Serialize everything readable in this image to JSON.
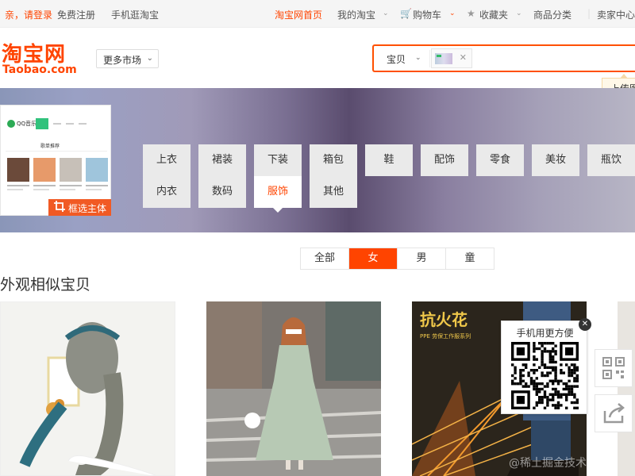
{
  "topbar": {
    "login": "亲，请登录",
    "register": "免费注册",
    "mobile": "手机逛淘宝",
    "home": "淘宝网首页",
    "my_taobao": "我的淘宝",
    "cart": "购物车",
    "favorites": "收藏夹",
    "categories": "商品分类",
    "separator": "|",
    "seller_center": "卖家中心",
    "chevron": "⌄",
    "cart_icon": "🛒",
    "star_icon": "★"
  },
  "header": {
    "logo_cn": "淘宝网",
    "logo_en": "Taobao.com",
    "more_markets": "更多市场",
    "chevron": "⌄"
  },
  "search": {
    "type_label": "宝贝",
    "type_chevron": "⌄",
    "remove_glyph": "✕",
    "upload_tip": "上传图"
  },
  "banner": {
    "preview": {
      "app_name": "QQ音乐",
      "section": "歌单推荐"
    },
    "crop_label": "框选主体",
    "categories": [
      {
        "label": "上衣",
        "active": false
      },
      {
        "label": "裙装",
        "active": false
      },
      {
        "label": "下装",
        "active": false
      },
      {
        "label": "箱包",
        "active": false
      },
      {
        "label": "鞋",
        "active": false
      },
      {
        "label": "配饰",
        "active": false
      },
      {
        "label": "零食",
        "active": false
      },
      {
        "label": "美妆",
        "active": false
      },
      {
        "label": "瓶饮",
        "active": false
      },
      {
        "label": "内衣",
        "active": false
      },
      {
        "label": "数码",
        "active": false
      },
      {
        "label": "服饰",
        "active": true
      },
      {
        "label": "其他",
        "active": false
      }
    ]
  },
  "gender_tabs": [
    {
      "label": "全部",
      "active": false
    },
    {
      "label": "女",
      "active": true
    },
    {
      "label": "男",
      "active": false
    },
    {
      "label": "童",
      "active": false
    }
  ],
  "results": {
    "title": "外观相似宝贝",
    "p3_brand": "抗火花",
    "p3_sub": "PPE 劳保工作服系列"
  },
  "qr_popup": {
    "title": "手机用更方便",
    "close": "✕"
  },
  "watermark": "@稀土掘金技术社区",
  "colors": {
    "accent": "#ff4400",
    "topbar_bg": "#f5f5f5",
    "category_bg": "#eaeaea"
  }
}
